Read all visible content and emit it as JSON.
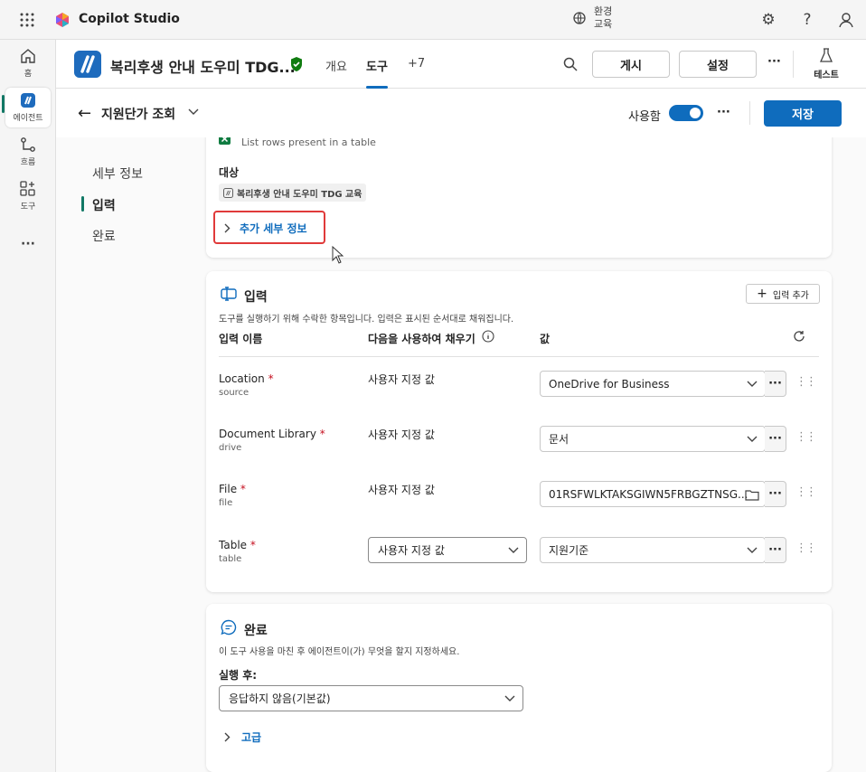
{
  "topbar": {
    "app_title": "Copilot Studio",
    "env_label": "환경",
    "env_name": "교육",
    "icons": [
      "waffle-icon",
      "environment-icon",
      "settings-icon",
      "help-icon",
      "user-icon"
    ]
  },
  "leftrail": {
    "items": [
      {
        "label": "홈",
        "icon": "home-icon"
      },
      {
        "label": "에이전트",
        "icon": "agent-icon"
      },
      {
        "label": "흐름",
        "icon": "flow-icon"
      },
      {
        "label": "도구",
        "icon": "tools-icon"
      }
    ],
    "more": "···"
  },
  "header": {
    "agent_name": "복리후생 안내 도우미 TDG...",
    "tabs": [
      "개요",
      "도구",
      "+7"
    ],
    "publish_label": "게시",
    "settings_label": "설정",
    "more": "···",
    "test_label": "테스트"
  },
  "subheader": {
    "title": "지원단가 조회",
    "enabled_label": "사용함",
    "more": "···",
    "save_label": "저장"
  },
  "sidenav": {
    "items": [
      "세부 정보",
      "입력",
      "완료"
    ]
  },
  "details_card": {
    "action_desc": "List rows present in a table",
    "target_label": "대상",
    "target_chip": "복리후생 안내 도우미 TDG 교육",
    "more_details": "추가 세부 정보"
  },
  "input_card": {
    "title": "입력",
    "add_input": "입력 추가",
    "description": "도구를 실행하기 위해 수락한 항목입니다. 입력은 표시된 순서대로 채워집니다.",
    "col_name": "입력 이름",
    "col_fill": "다음을 사용하여 채우기",
    "col_value": "값",
    "rows": [
      {
        "name": "Location",
        "sub": "source",
        "fill": "사용자 지정 값",
        "value": "OneDrive for Business",
        "kind": "dropdown"
      },
      {
        "name": "Document Library",
        "sub": "drive",
        "fill": "사용자 지정 값",
        "value": "문서",
        "kind": "dropdown"
      },
      {
        "name": "File",
        "sub": "file",
        "fill": "사용자 지정 값",
        "value": "01RSFWLKTAKSGIWN5FRBGZTNSG...",
        "kind": "file"
      },
      {
        "name": "Table",
        "sub": "table",
        "fill": "사용자 지정 값",
        "value": "지원기준",
        "kind": "dropdown"
      }
    ]
  },
  "completion_card": {
    "title": "완료",
    "description": "이 도구 사용을 마친 후 에이전트이(가) 무엇을 할지 지정하세요.",
    "after_label": "실행 후:",
    "after_value": "응답하지 않음(기본값)",
    "advanced": "고급"
  },
  "colors": {
    "accent": "#0f6cbd",
    "active_marker": "#117865",
    "required": "#c50f1f",
    "highlight_box": "#e03a3a"
  }
}
